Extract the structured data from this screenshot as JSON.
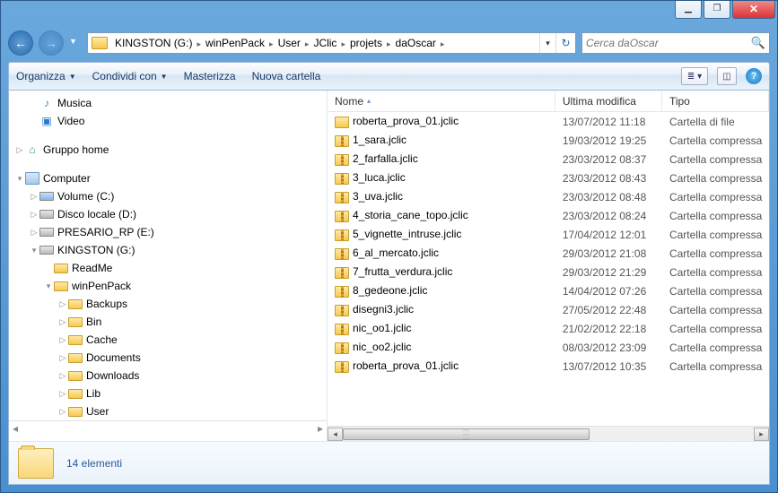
{
  "breadcrumbs": [
    "KINGSTON (G:)",
    "winPenPack",
    "User",
    "JClic",
    "projets",
    "daOscar"
  ],
  "search": {
    "placeholder": "Cerca daOscar"
  },
  "toolbar": {
    "organize": "Organizza",
    "share": "Condividi con",
    "burn": "Masterizza",
    "newfolder": "Nuova cartella"
  },
  "tree": {
    "music": "Musica",
    "video": "Video",
    "homegroup": "Gruppo home",
    "computer": "Computer",
    "drives": {
      "c": "Volume (C:)",
      "d": "Disco locale (D:)",
      "e": "PRESARIO_RP (E:)",
      "g": "KINGSTON (G:)"
    },
    "g_children": {
      "readme": "ReadMe",
      "winpenpack": "winPenPack"
    },
    "wpp_children": [
      "Backups",
      "Bin",
      "Cache",
      "Documents",
      "Downloads",
      "Lib",
      "User"
    ]
  },
  "columns": {
    "name": "Nome",
    "date": "Ultima modifica",
    "type": "Tipo"
  },
  "type_folder": "Cartella di file",
  "type_zip": "Cartella compressa",
  "files": [
    {
      "name": "roberta_prova_01.jclic",
      "date": "13/07/2012 11:18",
      "kind": "folder"
    },
    {
      "name": "1_sara.jclic",
      "date": "19/03/2012 19:25",
      "kind": "zip"
    },
    {
      "name": "2_farfalla.jclic",
      "date": "23/03/2012 08:37",
      "kind": "zip"
    },
    {
      "name": "3_luca.jclic",
      "date": "23/03/2012 08:43",
      "kind": "zip"
    },
    {
      "name": "3_uva.jclic",
      "date": "23/03/2012 08:48",
      "kind": "zip"
    },
    {
      "name": "4_storia_cane_topo.jclic",
      "date": "23/03/2012 08:24",
      "kind": "zip"
    },
    {
      "name": "5_vignette_intruse.jclic",
      "date": "17/04/2012 12:01",
      "kind": "zip"
    },
    {
      "name": "6_al_mercato.jclic",
      "date": "29/03/2012 21:08",
      "kind": "zip"
    },
    {
      "name": "7_frutta_verdura.jclic",
      "date": "29/03/2012 21:29",
      "kind": "zip"
    },
    {
      "name": "8_gedeone.jclic",
      "date": "14/04/2012 07:26",
      "kind": "zip"
    },
    {
      "name": "disegni3.jclic",
      "date": "27/05/2012 22:48",
      "kind": "zip"
    },
    {
      "name": "nic_oo1.jclic",
      "date": "21/02/2012 22:18",
      "kind": "zip"
    },
    {
      "name": "nic_oo2.jclic",
      "date": "08/03/2012 23:09",
      "kind": "zip"
    },
    {
      "name": "roberta_prova_01.jclic",
      "date": "13/07/2012 10:35",
      "kind": "zip"
    }
  ],
  "status": {
    "count": "14 elementi"
  }
}
